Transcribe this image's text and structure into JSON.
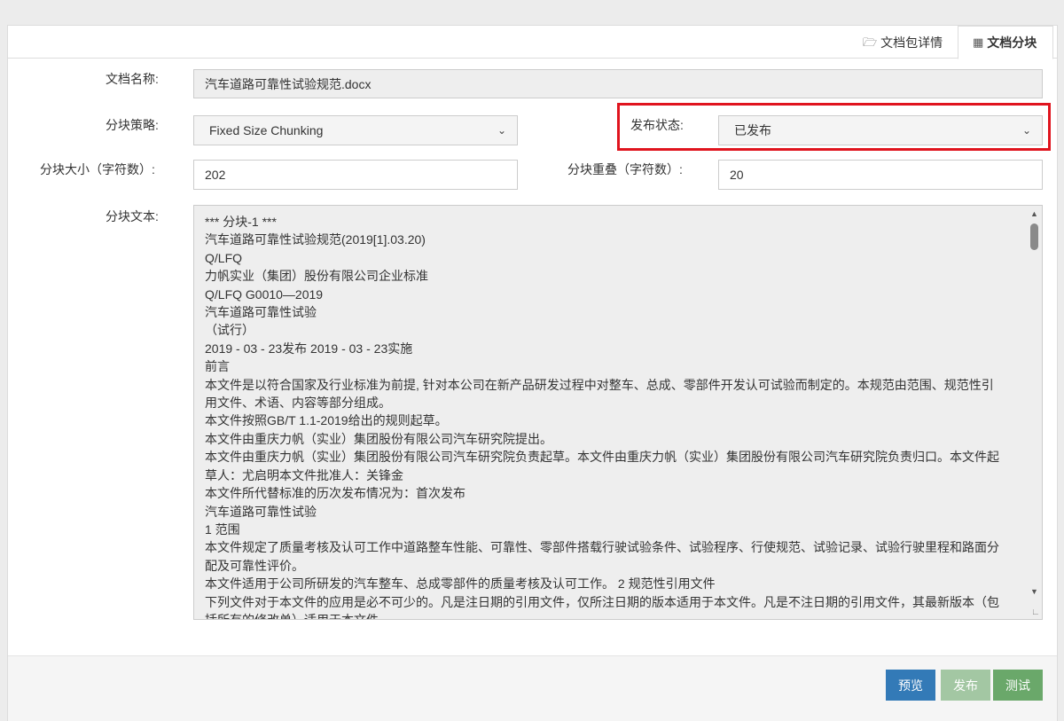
{
  "tabs": [
    {
      "label": "文档包详情",
      "icon": "folder-open-icon"
    },
    {
      "label": "文档分块",
      "icon": "table-icon",
      "active": true
    }
  ],
  "form": {
    "doc_name_label": "文档名称:",
    "doc_name_value": "汽车道路可靠性试验规范.docx",
    "strategy_label": "分块策略:",
    "strategy_value": "Fixed Size Chunking",
    "status_label": "发布状态:",
    "status_value": "已发布",
    "chunk_size_label": "分块大小（字符数）:",
    "chunk_size_value": "202",
    "overlap_label": "分块重叠（字符数）:",
    "overlap_value": "20",
    "text_label": "分块文本:"
  },
  "chunk_text_lines": [
    "*** 分块-1 ***",
    "汽车道路可靠性试验规范(2019[1].03.20)",
    "Q/LFQ",
    "力帆实业（集团）股份有限公司企业标准",
    "Q/LFQ G0010—2019",
    "汽车道路可靠性试验",
    "（试行）",
    "2019 - 03 - 23发布 2019 - 03 - 23实施",
    "前言",
    "本文件是以符合国家及行业标准为前提, 针对本公司在新产品研发过程中对整车、总成、零部件开发认可试验而制定的。本规范由范围、规范性引",
    "用文件、术语、内容等部分组成。",
    "本文件按照GB/T 1.1-2019给出的规则起草。",
    "本文件由重庆力帆（实业）集团股份有限公司汽车研究院提出。",
    "本文件由重庆力帆（实业）集团股份有限公司汽车研究院负责起草。本文件由重庆力帆（实业）集团股份有限公司汽车研究院负责归口。本文件起",
    "草人：尤启明本文件批准人：关锋金",
    "本文件所代替标准的历次发布情况为：首次发布",
    "汽车道路可靠性试验",
    "1 范围",
    "本文件规定了质量考核及认可工作中道路整车性能、可靠性、零部件搭载行驶试验条件、试验程序、行使规范、试验记录、试验行驶里程和路面分",
    "配及可靠性评价。",
    "本文件适用于公司所研发的汽车整车、总成零部件的质量考核及认可工作。 2 规范性引用文件",
    "下列文件对于本文件的应用是必不可少的。凡是注日期的引用文件，仅所注日期的版本适用于本文件。凡是不注日期的引用文件，其最新版本（包",
    "括所有的修改单）适用于本文件。"
  ],
  "buttons": {
    "preview": "预览",
    "publish": "发布",
    "test": "测试"
  },
  "colors": {
    "primary": "#337ab7",
    "success_disabled": "#a3c7a3",
    "success": "#6aa86a",
    "highlight": "#e0141e"
  }
}
